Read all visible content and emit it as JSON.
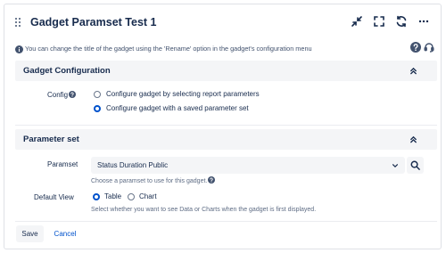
{
  "gadget": {
    "title": "Gadget Paramset Test 1",
    "info_text": "You can change the title of the gadget using the 'Rename' option in the gadget's configuration menu"
  },
  "config_section": {
    "header": "Gadget Configuration",
    "config_label": "Config",
    "options": [
      {
        "label": "Configure gadget by selecting report parameters",
        "selected": false
      },
      {
        "label": "Configure gadget with a saved parameter set",
        "selected": true
      }
    ]
  },
  "paramset_section": {
    "header": "Parameter set",
    "paramset_label": "Paramset",
    "paramset_value": "Status Duration Public",
    "paramset_hint": "Choose a paramset to use for this gadget.",
    "default_view_label": "Default View",
    "view_options": [
      {
        "label": "Table",
        "selected": true
      },
      {
        "label": "Chart",
        "selected": false
      }
    ],
    "default_view_hint": "Select whether you want to see Data or Charts when the gadget is first displayed."
  },
  "actions": {
    "save_label": "Save",
    "cancel_label": "Cancel"
  },
  "colors": {
    "accent": "#0052cc",
    "header_bg": "#f4f5f7",
    "text": "#172b4d",
    "muted": "#5e6c84"
  },
  "icons": [
    "drag-handle-icon",
    "minimize-icon",
    "maximize-icon",
    "refresh-icon",
    "more-icon",
    "info-icon",
    "help-icon",
    "headset-icon",
    "chevron-up-icon",
    "chevron-down-icon",
    "search-icon"
  ]
}
